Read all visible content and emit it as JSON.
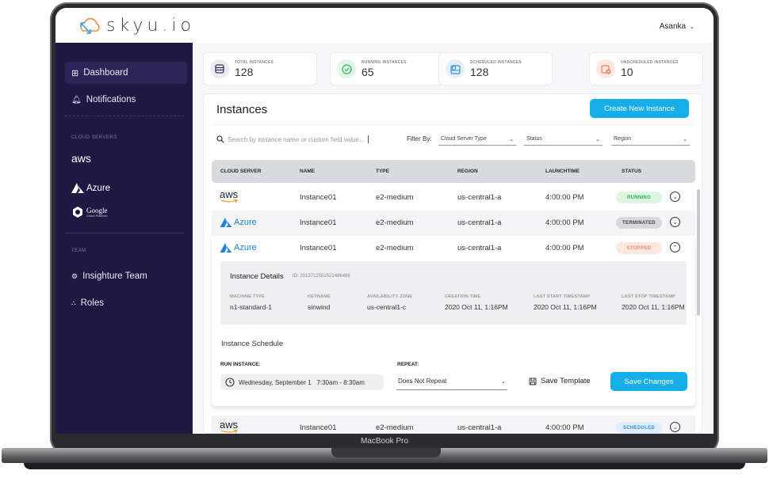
{
  "app": {
    "logo_text": "skyu.io",
    "user_name": "Asanka",
    "device_label": "MacBook Pro"
  },
  "sidebar": {
    "items": [
      {
        "label": "Dashboard",
        "icon": "grid-icon",
        "active": true
      },
      {
        "label": "Notifications",
        "icon": "bell-icon",
        "active": false
      }
    ],
    "cloud_heading": "CLOUD SERVERS",
    "clouds": [
      {
        "label": "aws"
      },
      {
        "label": "Azure"
      },
      {
        "label": "Google",
        "sub": "Cloud Platform"
      }
    ],
    "team_heading": "TEAM",
    "team_items": [
      {
        "label": "Insighture Team",
        "icon": "team-icon"
      },
      {
        "label": "Roles",
        "icon": "roles-icon"
      }
    ]
  },
  "stats": [
    {
      "label": "TOTAL INSTANCES",
      "value": "128",
      "icon": "server-stack-icon",
      "color": "#3a3560",
      "bg": "#ececf0"
    },
    {
      "label": "RUNNING INSTANCES",
      "value": "65",
      "icon": "check-circle-icon",
      "color": "#2bbf5a",
      "bg": "#e3f6e8"
    },
    {
      "label": "SCHEDULED INSTANCES",
      "value": "128",
      "icon": "calendar-clock-icon",
      "color": "#2f8fe0",
      "bg": "#e3effb"
    },
    {
      "label": "UNSCHEDULED INSTANCES",
      "value": "10",
      "icon": "calendar-x-icon",
      "color": "#f07a4a",
      "bg": "#fde9e1"
    }
  ],
  "instances": {
    "title": "Instances",
    "create_label": "Create New Instance",
    "search_placeholder": "Search by instance name or custom field value...",
    "filter_label": "Filter By:",
    "filters": [
      {
        "label": "Cloud Server Type"
      },
      {
        "label": "Status"
      },
      {
        "label": "Region"
      }
    ],
    "columns": [
      "CLOUD SERVER",
      "NAME",
      "TYPE",
      "REGION",
      "LAUNCHTIME",
      "STATUS"
    ],
    "rows": [
      {
        "cloud": "aws",
        "name": "Instance01",
        "type": "e2-medium",
        "region": "us-central1-a",
        "launch": "4:00:00 PM",
        "status": "RUNNING",
        "status_fg": "#2bb24c",
        "status_bg": "#dff5e4"
      },
      {
        "cloud": "Azure",
        "name": "Instance01",
        "type": "e2-medium",
        "region": "us-central1-a",
        "launch": "4:00:00 PM",
        "status": "TERMINATED",
        "status_fg": "#444",
        "status_bg": "#d8d8dd"
      },
      {
        "cloud": "Azure",
        "name": "Instance01",
        "type": "e2-medium",
        "region": "us-central1-a",
        "launch": "4:00:00 PM",
        "status": "STOPPED",
        "status_fg": "#f08a6a",
        "status_bg": "#fde8e0"
      },
      {
        "cloud": "aws",
        "name": "Instance01",
        "type": "e2-medium",
        "region": "us-central1-a",
        "launch": "4:00:00 PM",
        "status": "SCHEDULED",
        "status_fg": "#2f8fe0",
        "status_bg": "#e0eefb"
      }
    ],
    "details": {
      "title": "Instance Details",
      "id_text": "ID: 2013712551521486486",
      "fields": [
        {
          "label": "MACHINE TYPE",
          "value": "n1-standard-1"
        },
        {
          "label": "KEYNAME",
          "value": "sinwind"
        },
        {
          "label": "AVAILABILITY ZONE",
          "value": "us-central1-c"
        },
        {
          "label": "CREATION TIME",
          "value": "2020 Oct 11, 1:16PM"
        },
        {
          "label": "LAST START TIMESTAMP",
          "value": "2020 Oct 11, 1:16PM"
        },
        {
          "label": "LAST STOP TIMESTAMP",
          "value": "2020 Oct 11, 1:16PM"
        }
      ]
    },
    "schedule": {
      "title": "Instance Schedule",
      "run_label": "RUN INSTANCE:",
      "run_value": "Wednesday, September 1   7:30am - 8:30am",
      "repeat_label": "REPEAT:",
      "repeat_value": "Does Not Repeat",
      "save_template_label": "Save Template",
      "save_changes_label": "Save Changes"
    }
  }
}
